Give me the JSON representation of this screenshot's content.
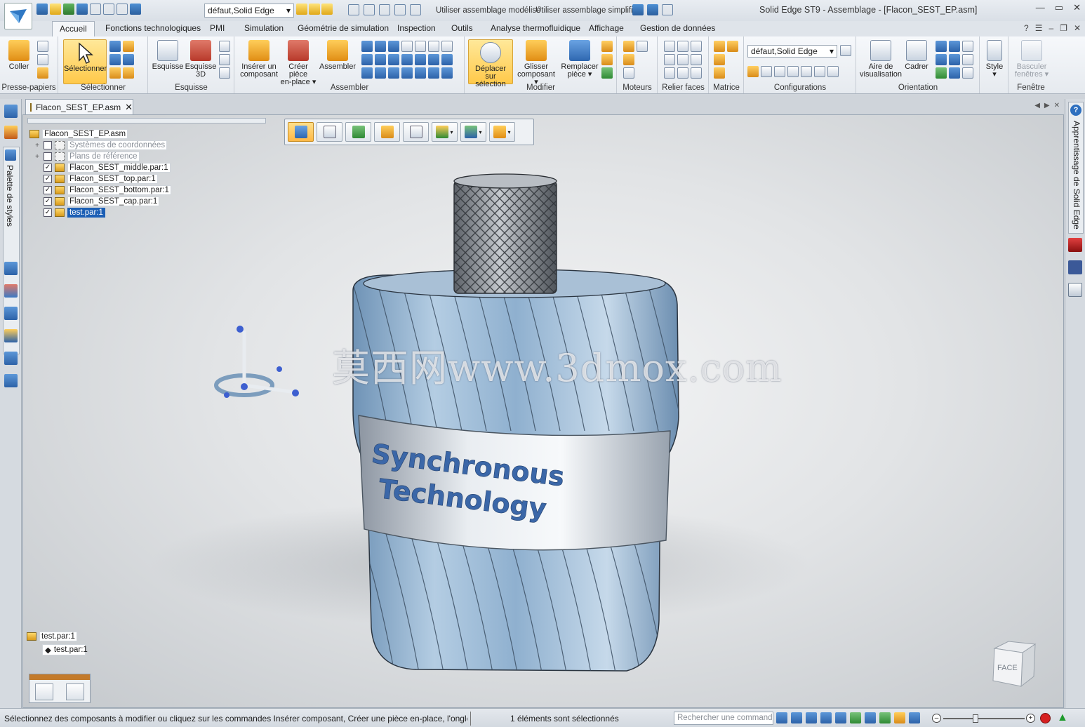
{
  "titlebar": {
    "window_title": "Solid Edge ST9 - Assemblage - [Flacon_SEST_EP.asm]",
    "theme_select": "défaut,Solid Edge",
    "qat_label_1": "Utiliser assemblage modélisé",
    "qat_label_2": "Utiliser assemblage simplifié",
    "controls": {
      "minimize": "—",
      "maximize": "▭",
      "close": "✕"
    }
  },
  "ribbon": {
    "tabs": [
      "Accueil",
      "Fonctions technologiques",
      "PMI",
      "Simulation",
      "Géométrie de simulation",
      "Inspection",
      "Outils",
      "Analyse thermofluidique",
      "Affichage",
      "Gestion de données"
    ],
    "active_tab": "Accueil",
    "groups": {
      "clipboard": {
        "label": "Presse-papiers",
        "paste": "Coller"
      },
      "select": {
        "label": "Sélectionner",
        "select": "Sélectionner"
      },
      "sketch": {
        "label": "Esquisse",
        "sketch": "Esquisse",
        "sketch3d_1": "Esquisse",
        "sketch3d_2": "3D"
      },
      "assemble": {
        "label": "Assembler",
        "insert_1": "Insérer un",
        "insert_2": "composant",
        "create_1": "Créer pièce",
        "create_2": "en-place",
        "assemble": "Assembler"
      },
      "modify": {
        "label": "Modifier",
        "move_1": "Déplacer sur",
        "move_2": "sélection",
        "drag_1": "Glisser",
        "drag_2": "composant",
        "replace_1": "Remplacer",
        "replace_2": "pièce"
      },
      "motors": {
        "label": "Moteurs"
      },
      "faces": {
        "label": "Relier faces"
      },
      "pattern": {
        "label": "Matrice"
      },
      "configs": {
        "label": "Configurations",
        "select": "défaut,Solid Edge"
      },
      "orient": {
        "label": "Orientation",
        "view_area_1": "Aire de",
        "view_area_2": "visualisation",
        "fit": "Cadrer"
      },
      "style": {
        "label": "Style"
      },
      "window": {
        "label": "Fenêtre",
        "switch_1": "Basculer",
        "switch_2": "fenêtres"
      }
    }
  },
  "document": {
    "tab_name": "Flacon_SEST_EP.asm",
    "tree": [
      {
        "label": "Flacon_SEST_EP.asm",
        "kind": "root"
      },
      {
        "label": "Systèmes de coordonnées",
        "kind": "folder",
        "checked": false
      },
      {
        "label": "Plans de référence",
        "kind": "folder",
        "checked": false
      },
      {
        "label": "Flacon_SEST_middle.par:1",
        "kind": "part",
        "checked": true
      },
      {
        "label": "Flacon_SEST_top.par:1",
        "kind": "part",
        "checked": true
      },
      {
        "label": "Flacon_SEST_bottom.par:1",
        "kind": "part",
        "checked": true
      },
      {
        "label": "Flacon_SEST_cap.par:1",
        "kind": "part",
        "checked": true
      },
      {
        "label": "test.par:1",
        "kind": "part",
        "checked": true,
        "selected": true
      }
    ],
    "selection_tree": {
      "root": "test.par:1",
      "child": "test.par:1"
    }
  },
  "viewport": {
    "label_line1": "Synchronous",
    "label_line2": "Technology",
    "watermark": "莫西网www.3dmox.com",
    "view_cube_face": "FACE"
  },
  "side_panels": {
    "left_palette": "Palette de styles",
    "right_panel": "Apprentissage de Solid Edge"
  },
  "statusbar": {
    "prompt": "Sélectionnez des composants à modifier ou cliquez sur les commandes Insérer composant, Créer une pièce en-place, l'onglet",
    "selection_count": "1 éléments sont sélectionnés",
    "search_placeholder": "Rechercher une commande"
  },
  "colors": {
    "accent_highlight": "#ffc94a",
    "selection_blue": "#1c5fb5",
    "bottle_glass": "#7fa3c4",
    "label_text": "#3b67a8"
  }
}
